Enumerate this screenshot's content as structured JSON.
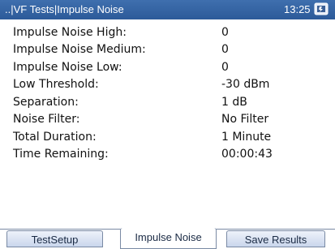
{
  "titlebar": {
    "title": "..|VF Tests|Impulse Noise",
    "time": "13:25"
  },
  "rows": [
    {
      "label": "Impulse Noise High:",
      "value": "0"
    },
    {
      "label": "Impulse Noise Medium:",
      "value": "0"
    },
    {
      "label": "Impulse Noise Low:",
      "value": "0"
    },
    {
      "label": "Low Threshold:",
      "value": "-30 dBm"
    },
    {
      "label": "Separation:",
      "value": "1 dB"
    },
    {
      "label": "Noise Filter:",
      "value": "No Filter"
    },
    {
      "label": "Total Duration:",
      "value": "1 Minute"
    },
    {
      "label": "Time Remaining:",
      "value": "00:00:43"
    }
  ],
  "tabs": [
    {
      "label": "TestSetup",
      "active": false
    },
    {
      "label": "Impulse Noise",
      "active": true
    },
    {
      "label": "Save Results",
      "active": false
    }
  ],
  "icons": {
    "status": "battery-charging-icon"
  },
  "colors": {
    "titlebar": "#2c5a99",
    "tab": "#c9d6ec"
  }
}
